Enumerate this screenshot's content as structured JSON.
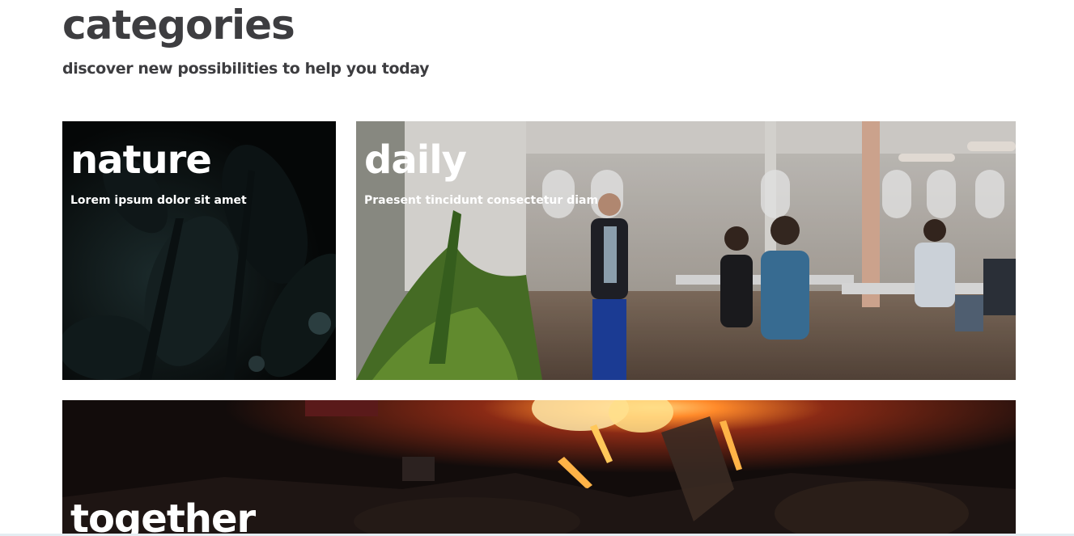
{
  "section": {
    "title": "categories",
    "subtitle": "discover new possibilities to help you today"
  },
  "cards": [
    {
      "title": "nature",
      "description": "Lorem ipsum dolor sit amet"
    },
    {
      "title": "daily",
      "description": "Praesent tincidunt consectetur diam"
    },
    {
      "title": "together"
    }
  ],
  "colors": {
    "heading_text": "#3d3d40",
    "card_text": "#ffffff",
    "background": "#ffffff"
  }
}
